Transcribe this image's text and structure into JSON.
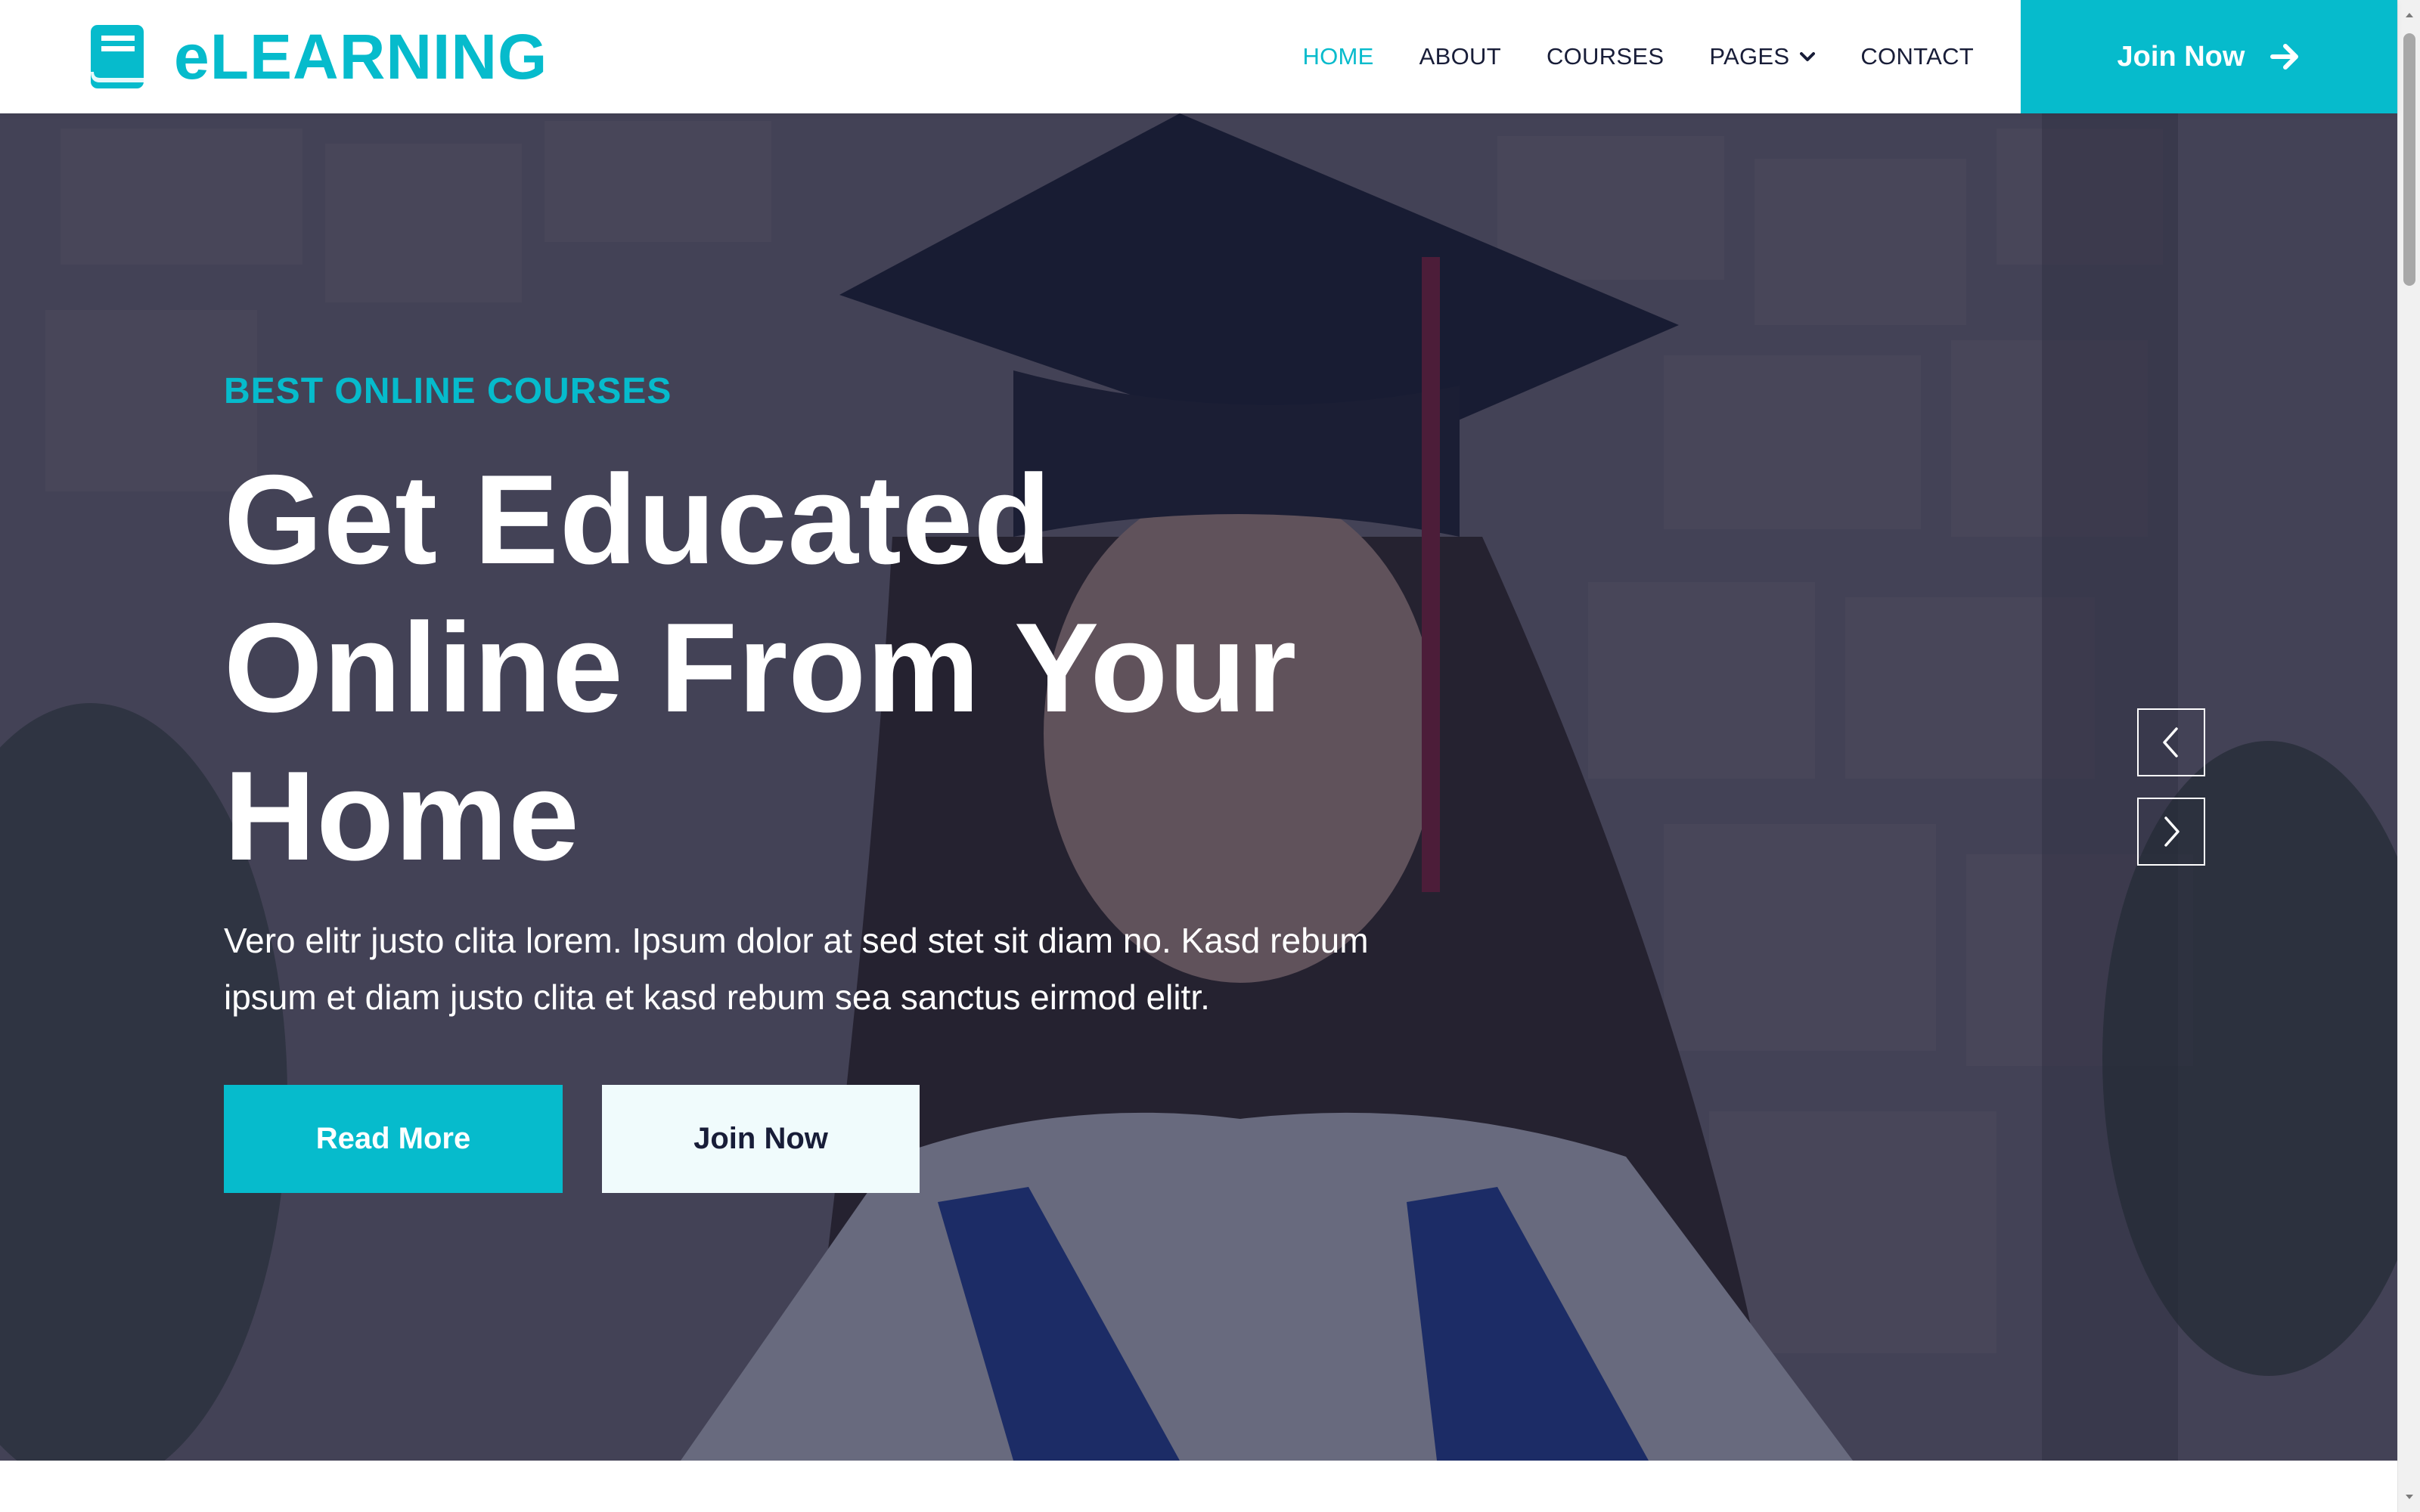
{
  "brand": {
    "name": "eLEARNING",
    "icon": "book-icon"
  },
  "nav": {
    "items": [
      {
        "label": "HOME",
        "active": true
      },
      {
        "label": "ABOUT",
        "active": false
      },
      {
        "label": "COURSES",
        "active": false
      },
      {
        "label": "PAGES",
        "active": false,
        "has_dropdown": true
      },
      {
        "label": "CONTACT",
        "active": false
      }
    ],
    "join_button": {
      "label": "Join Now",
      "icon": "arrow-right-icon"
    }
  },
  "hero": {
    "eyebrow": "BEST ONLINE COURSES",
    "headline_lines": [
      "Get Educated",
      "Online From Your",
      "Home"
    ],
    "lead_lines": [
      "Vero elitr justo clita lorem. Ipsum dolor at sed stet sit diam no. Kasd rebum",
      "ipsum et diam justo clita et kasd rebum sea sanctus eirmod elitr."
    ],
    "primary_button": "Read More",
    "secondary_button": "Join Now",
    "prev_icon": "chevron-left-icon",
    "next_icon": "chevron-right-icon"
  },
  "colors": {
    "accent": "#06BBCC",
    "dark": "#181D38",
    "light_button": "#F0FBFC"
  }
}
